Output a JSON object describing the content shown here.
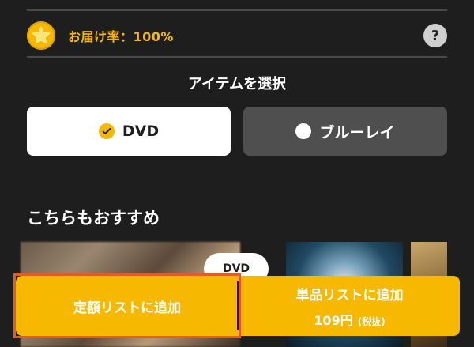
{
  "delivery": {
    "rate_label": "お届け率：100%",
    "help_symbol": "?"
  },
  "select_item": {
    "title": "アイテムを選択",
    "options": [
      {
        "label": "DVD",
        "selected": true
      },
      {
        "label": "ブルーレイ",
        "selected": false
      }
    ]
  },
  "recommend": {
    "title": "こちらもおすすめ",
    "badge": "DVD"
  },
  "actions": {
    "subscription_label": "定額リストに追加",
    "single_label": "単品リストに追加",
    "single_price": "109円",
    "tax_note": "(税抜)"
  },
  "colors": {
    "background": "#1e1e1e",
    "accent": "#f6b800",
    "highlight_outline": "#e8582a"
  }
}
